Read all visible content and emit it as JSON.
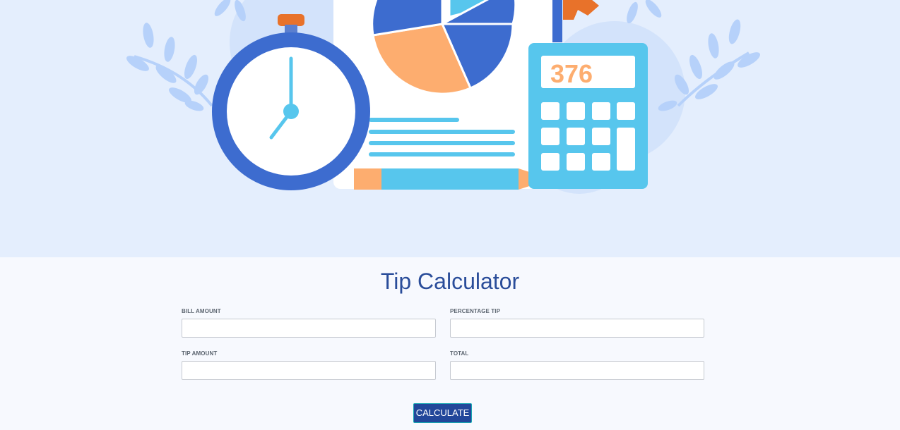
{
  "hero": {
    "calculator_display": "376"
  },
  "title": "Tip Calculator",
  "fields": {
    "bill_amount": {
      "label": "BILL AMOUNT",
      "value": "",
      "placeholder": ""
    },
    "percentage_tip": {
      "label": "PERCENTAGE TIP",
      "value": "",
      "placeholder": ""
    },
    "tip_amount": {
      "label": "TIP AMOUNT",
      "value": "",
      "placeholder": ""
    },
    "total": {
      "label": "TOTAL",
      "value": "",
      "placeholder": ""
    }
  },
  "calculate_button": "CALCULATE",
  "colors": {
    "hero_background": "#e4eefd",
    "page_background": "#f7f9fe",
    "title": "#2a4d9a",
    "button": "#22479a",
    "illustration_blue": "#3d6ccf",
    "illustration_light_blue": "#57c6ed",
    "illustration_orange": "#fdad6f",
    "illustration_dark_orange": "#e8722a"
  },
  "icons": [
    "stopwatch-icon",
    "pie-chart-icon",
    "document-icon",
    "pencil-icon",
    "calculator-icon",
    "leaf-branch-icon"
  ]
}
